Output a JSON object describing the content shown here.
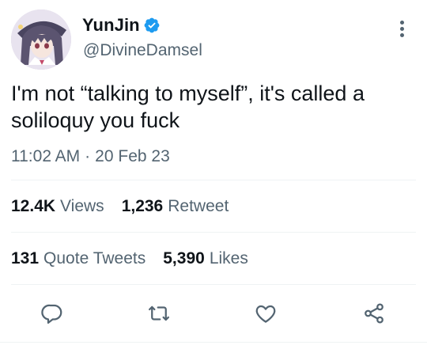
{
  "author": {
    "display_name": "YunJin",
    "handle": "@DivineDamsel"
  },
  "tweet": {
    "text": "I'm not “talking to myself”, it's called a soliloquy you fuck",
    "time": "11:02 AM",
    "separator": "·",
    "date": "20 Feb 23"
  },
  "stats": {
    "views_count": "12.4K",
    "views_label": "Views",
    "retweets_count": "1,236",
    "retweets_label": "Retweet",
    "quotes_count": "131",
    "quotes_label": "Quote Tweets",
    "likes_count": "5,390",
    "likes_label": "Likes"
  },
  "icons": {
    "verified": "verified-badge-icon",
    "more": "more-vertical-icon",
    "reply": "reply-icon",
    "retweet": "retweet-icon",
    "like": "heart-icon",
    "share": "share-icon"
  },
  "colors": {
    "verified_blue": "#1d9bf0",
    "secondary_text": "#536471",
    "primary_text": "#0f1419"
  }
}
